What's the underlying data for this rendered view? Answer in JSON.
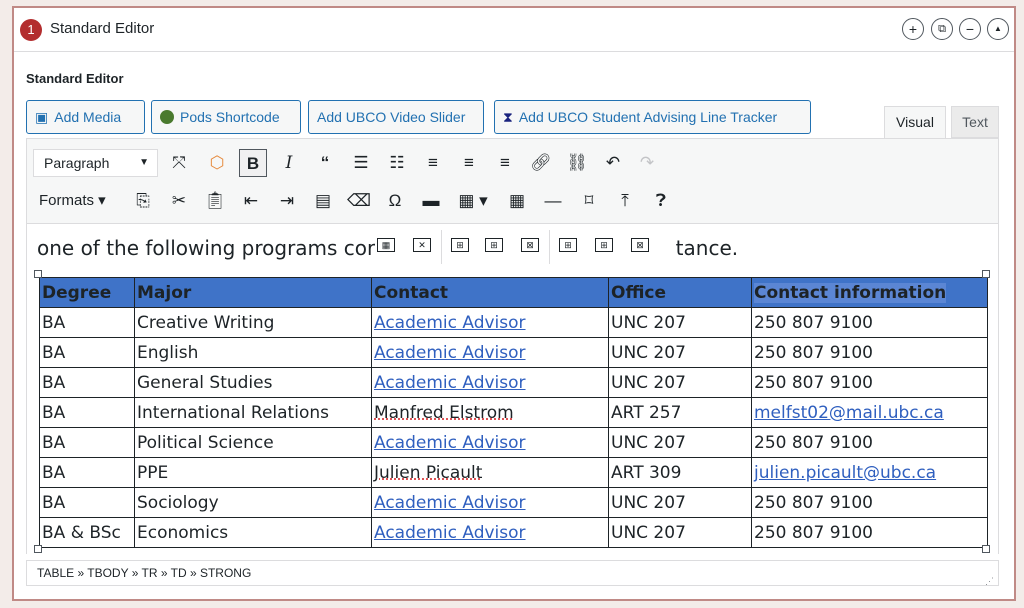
{
  "panel": {
    "badge": "1",
    "title": "Standard Editor",
    "controls": [
      "+",
      "⧉",
      "−",
      "▲"
    ]
  },
  "section_label": "Standard Editor",
  "media_buttons": [
    {
      "label": "Add Media",
      "icon": "media-icon"
    },
    {
      "label": "Pods Shortcode",
      "icon": "pods-icon"
    },
    {
      "label": "Add UBCO Video Slider",
      "icon": ""
    },
    {
      "label": "Add UBCO Student Advising Line Tracker",
      "icon": "hourglass-icon"
    }
  ],
  "tabs": {
    "visual": "Visual",
    "text": "Text"
  },
  "toolbar": {
    "format_select": "Paragraph",
    "formats_label": "Formats"
  },
  "editor": {
    "intro_start": "one of the following programs cor",
    "intro_end": "stance."
  },
  "table": {
    "headers": [
      "Degree",
      "Major",
      "Contact",
      "Office",
      "Contact information"
    ],
    "rows": [
      [
        "BA",
        "Creative Writing",
        "Academic Advisor",
        "UNC 207",
        "250 807 9100"
      ],
      [
        "BA",
        "English",
        "Academic Advisor",
        "UNC 207",
        "250 807 9100"
      ],
      [
        "BA",
        "General Studies",
        "Academic Advisor",
        "UNC 207",
        "250 807 9100"
      ],
      [
        "BA",
        "International Relations",
        "Manfred Elstrom",
        "ART 257",
        "melfst02@mail.ubc.ca"
      ],
      [
        "BA",
        "Political Science",
        "Academic Advisor",
        "UNC 207",
        "250 807 9100"
      ],
      [
        "BA",
        "PPE",
        "Julien Picault",
        "ART 309",
        "julien.picault@ubc.ca"
      ],
      [
        "BA",
        "Sociology",
        "Academic Advisor",
        "UNC 207",
        "250 807 9100"
      ],
      [
        "BA & BSc",
        "Economics",
        "Academic Advisor",
        "UNC 207",
        "250 807 9100"
      ]
    ],
    "link_cells": [
      [
        0,
        2
      ],
      [
        1,
        2
      ],
      [
        2,
        2
      ],
      [
        3,
        4
      ],
      [
        4,
        2
      ],
      [
        5,
        4
      ],
      [
        6,
        2
      ],
      [
        7,
        2
      ]
    ]
  },
  "statusbar": {
    "path": "TABLE » TBODY » TR » TD » STRONG"
  },
  "colors": {
    "header_bg": "#3f73c8",
    "link": "#2f5fbf",
    "accent": "#2271b1",
    "badge": "#b32d2e"
  }
}
